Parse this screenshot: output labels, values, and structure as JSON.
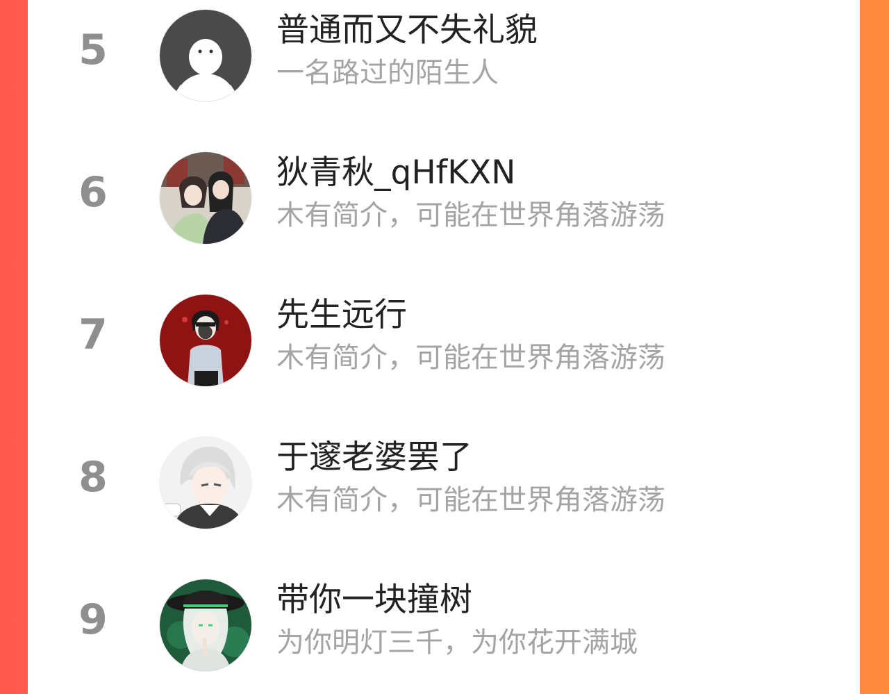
{
  "ranking": {
    "entries": [
      {
        "rank": "5",
        "name": "普通而又不失礼貌",
        "description": "一名路过的陌生人",
        "avatar_icon": "default-ghost-avatar"
      },
      {
        "rank": "6",
        "name": "狄青秋_qHfKXN",
        "description": "木有简介，可能在世界角落游荡",
        "avatar_icon": "two-characters-avatar"
      },
      {
        "rank": "7",
        "name": "先生远行",
        "description": "木有简介，可能在世界角落游荡",
        "avatar_icon": "boy-red-background-avatar"
      },
      {
        "rank": "8",
        "name": "于邃老婆罢了",
        "description": "木有简介，可能在世界角落游荡",
        "avatar_icon": "white-hair-boy-avatar"
      },
      {
        "rank": "9",
        "name": "带你一块撞树",
        "description": "为你明灯三千，为你花开满城",
        "avatar_icon": "green-hat-character-avatar"
      }
    ]
  },
  "colors": {
    "background_left": "#ff5a4e",
    "background_right": "#ff8a3d",
    "rank_number": "#8f8f8f",
    "name_text": "#222222",
    "description_text": "#a4a4a4"
  }
}
